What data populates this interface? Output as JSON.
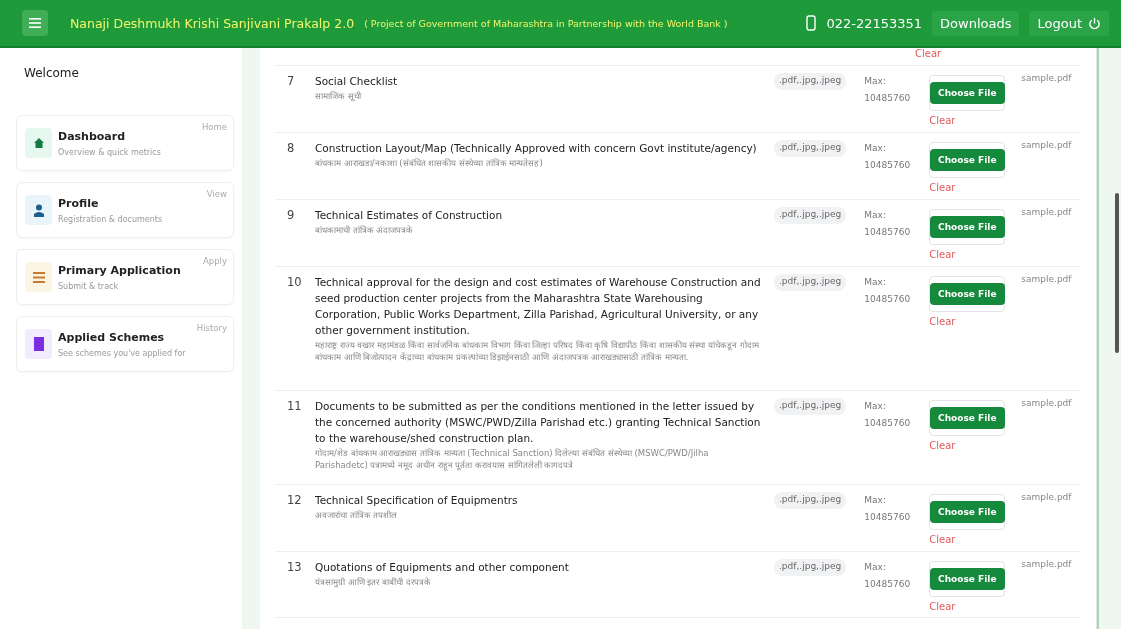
{
  "header": {
    "title": "Nanaji Deshmukh Krishi Sanjivani Prakalp 2.0",
    "subtitle": "( Project of Government of Maharashtra in Partnership with the World Bank )",
    "phone": "022-22153351",
    "downloads": "Downloads",
    "logout": "Logout"
  },
  "sidebar": {
    "welcome": "Welcome",
    "items": [
      {
        "kind": "dashboard",
        "title": "Dashboard",
        "subtitle": "Overview & quick metrics",
        "action": "Home"
      },
      {
        "kind": "profile",
        "title": "Profile",
        "subtitle": "Registration & documents",
        "action": "View"
      },
      {
        "kind": "application",
        "title": "Primary Application",
        "subtitle": "Submit & track",
        "action": "Apply"
      },
      {
        "kind": "schemes",
        "title": "Applied Schemes",
        "subtitle": "See schemes you've applied for",
        "action": "History"
      }
    ]
  },
  "documents": {
    "top_clear": "Clear",
    "rows": [
      {
        "number": "7",
        "title": "Social Checklist",
        "title_mr": "सामाजिक सूची",
        "formats": ".pdf,.jpg,.jpeg",
        "max": "Max: 10485760",
        "button": "Choose File",
        "clear": "Clear",
        "file": "sample.pdf"
      },
      {
        "number": "8",
        "title": "Construction Layout/Map (Technically Approved with concern Govt institute/agency)",
        "title_mr": "बांधकाम आराखडा/नकाशा (संबंधित शासकीय संस्थेच्या तांत्रिक मान्यतेसह)",
        "formats": ".pdf,.jpg,.jpeg",
        "max": "Max: 10485760",
        "button": "Choose File",
        "clear": "Clear",
        "file": "sample.pdf"
      },
      {
        "number": "9",
        "title": "Technical Estimates of Construction",
        "title_mr": "बांधकामाची तांत्रिक अंदाजपत्रके",
        "formats": ".pdf,.jpg,.jpeg",
        "max": "Max: 10485760",
        "button": "Choose File",
        "clear": "Clear",
        "file": "sample.pdf"
      },
      {
        "number": "10",
        "title": "Technical approval for the design and cost estimates of Warehouse Construction and seed production center projects from the Maharashtra State Warehousing Corporation, Public Works Department, Zilla Parishad, Agricultural University, or any other government institution.",
        "title_mr": "महाराष्ट्र राज्य वखार महामंडळ किंवा सार्वजनिक बांधकाम विभाग किंवा जिल्हा परिषद किंवा कृषि विद्यापीठ किंवा शासकीय संस्था यांचेकडून गोदाम बांधकाम आणि बिजोत्पादन केंद्राच्या बांधकाम प्रकल्पांच्या डिझाईनसाठी आणि अंदाजपत्रक आराखड्यासाठी तांत्रिक मान्यता.",
        "formats": ".pdf,.jpg,.jpeg",
        "max": "Max: 10485760",
        "button": "Choose File",
        "clear": "Clear",
        "file": "sample.pdf"
      },
      {
        "number": "11",
        "title": "Documents to be submitted as per the conditions mentioned in the letter issued by the concerned authority (MSWC/PWD/Zilla Parishad etc.) granting Technical Sanction to the warehouse/shed construction plan.",
        "title_mr": "गोदाम/शेड बांधकाम आराखड्यास तांत्रिक मान्यता (Technical Sanction) दिलेल्या संबंधित संस्थेच्या (MSWC/PWD/Jilha Parishadetc) पत्रामध्ये नमूद अधीन राहून पूर्तता करावयास सांगितलेली कागदपत्रे",
        "formats": ".pdf,.jpg,.jpeg",
        "max": "Max: 10485760",
        "button": "Choose File",
        "clear": "Clear",
        "file": "sample.pdf"
      },
      {
        "number": "12",
        "title": "Technical Specification of Equipmentrs",
        "title_mr": "अवजारांचा तांत्रिक तपशील",
        "formats": ".pdf,.jpg,.jpeg",
        "max": "Max: 10485760",
        "button": "Choose File",
        "clear": "Clear",
        "file": "sample.pdf"
      },
      {
        "number": "13",
        "title": "Quotations of Equipments and other component",
        "title_mr": "यंत्रसामुग्री आणि इतर बाबींची दरपत्रके",
        "formats": ".pdf,.jpg,.jpeg",
        "max": "Max: 10485760",
        "button": "Choose File",
        "clear": "Clear",
        "file": "sample.pdf"
      }
    ]
  }
}
